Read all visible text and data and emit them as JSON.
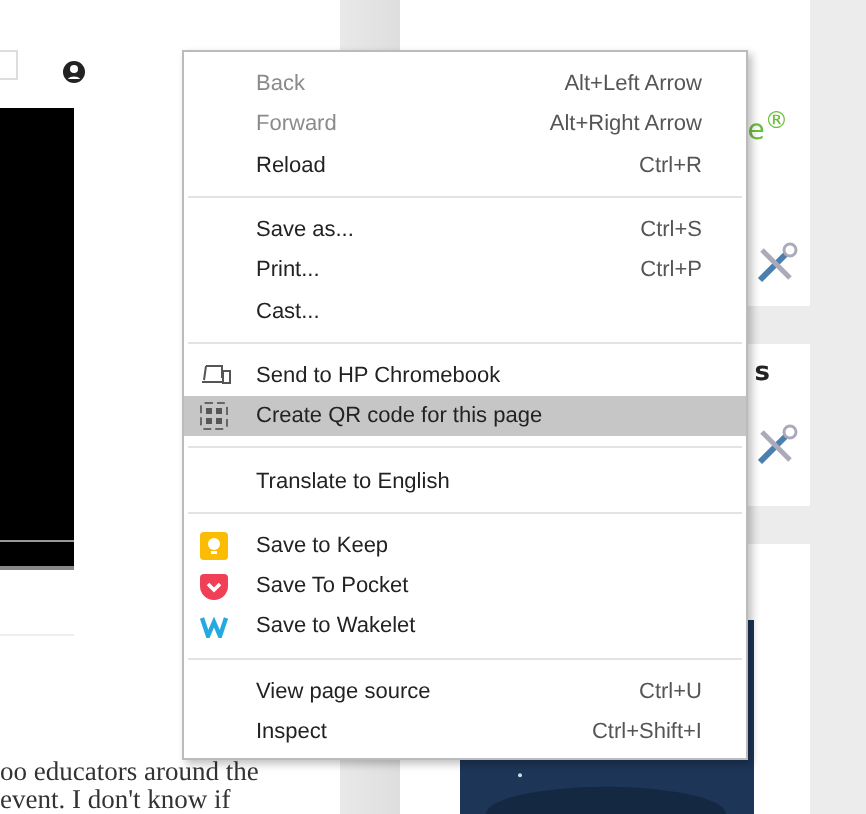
{
  "article": {
    "lines": [
      "oo educators around the",
      "event. I don't know if"
    ]
  },
  "sidebar": {
    "cards": [
      {
        "kind": "logo",
        "texts": [
          "e$^{®}$"
        ]
      },
      {
        "kind": "heading",
        "texts": [
          "s"
        ]
      },
      {
        "kind": "book"
      }
    ]
  },
  "context_menu": {
    "groups": [
      [
        {
          "label": "Back",
          "shortcut": "Alt+Left Arrow",
          "disabled": true,
          "selected": false
        },
        {
          "label": "Forward",
          "shortcut": "Alt+Right Arrow",
          "disabled": true,
          "selected": false
        },
        {
          "label": "Reload",
          "shortcut": "Ctrl+R",
          "disabled": false,
          "selected": false
        }
      ],
      [
        {
          "label": "Save as...",
          "shortcut": "Ctrl+S",
          "disabled": false,
          "selected": false
        },
        {
          "label": "Print...",
          "shortcut": "Ctrl+P",
          "disabled": false,
          "selected": false
        },
        {
          "label": "Cast...",
          "disabled": false,
          "selected": false
        }
      ],
      [
        {
          "label": "Send to HP Chromebook",
          "kind": "device",
          "disabled": false,
          "selected": false
        },
        {
          "label": "Create QR code for this page",
          "kind": "qr",
          "disabled": false,
          "selected": true
        }
      ],
      [
        {
          "label": "Translate to English",
          "disabled": false,
          "selected": false
        }
      ],
      [
        {
          "label": "Save to Keep",
          "kind": "keep",
          "disabled": false,
          "selected": false
        },
        {
          "label": "Save To Pocket",
          "kind": "pocket",
          "disabled": false,
          "selected": false
        },
        {
          "label": "Save to Wakelet",
          "kind": "wakelet",
          "disabled": false,
          "selected": false
        }
      ],
      [
        {
          "label": "View page source",
          "shortcut": "Ctrl+U",
          "disabled": false,
          "selected": false
        },
        {
          "label": "Inspect",
          "shortcut": "Ctrl+Shift+I",
          "disabled": false,
          "selected": false
        }
      ]
    ]
  }
}
